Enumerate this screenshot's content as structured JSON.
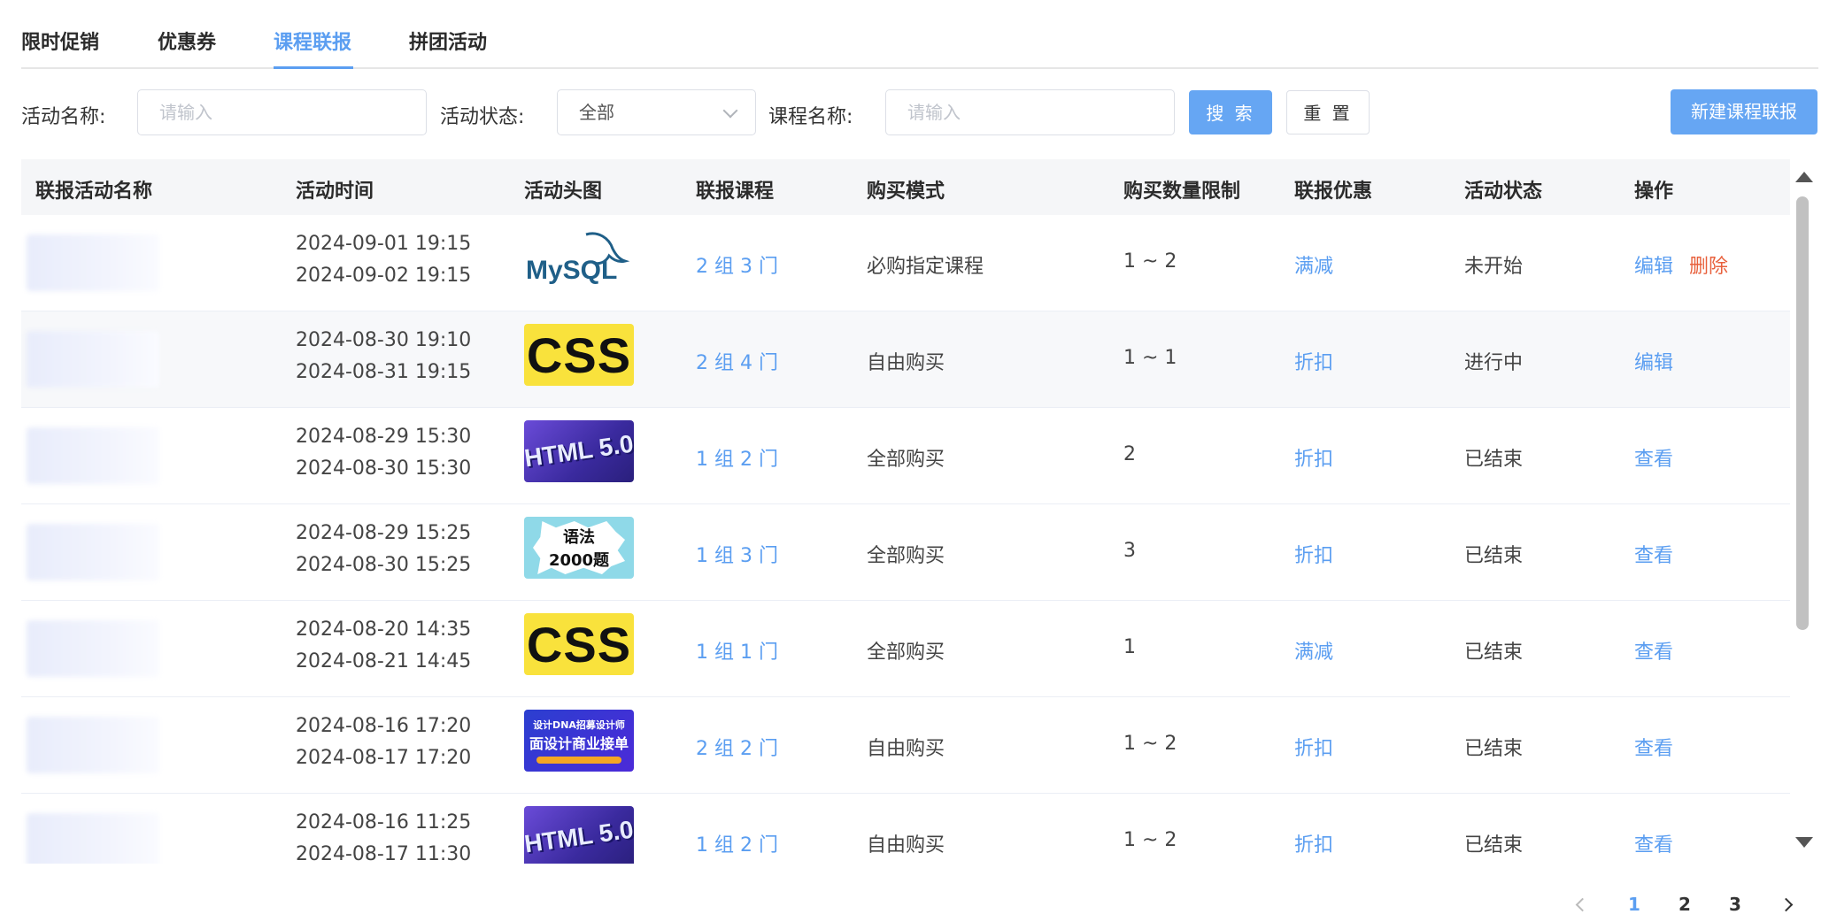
{
  "tabs": [
    {
      "label": "限时促销"
    },
    {
      "label": "优惠券"
    },
    {
      "label": "课程联报"
    },
    {
      "label": "拼团活动"
    }
  ],
  "active_tab": "课程联报",
  "filters": {
    "activity_name_label": "活动名称:",
    "activity_name_placeholder": "请输入",
    "status_label": "活动状态:",
    "status_value": "全部",
    "course_name_label": "课程名称:",
    "course_name_placeholder": "请输入",
    "search_label": "搜 索",
    "reset_label": "重 置",
    "new_label": "新建课程联报"
  },
  "table": {
    "headers": [
      "联报活动名称",
      "活动时间",
      "活动头图",
      "联报课程",
      "购买模式",
      "购买数量限制",
      "联报优惠",
      "活动状态",
      "操作"
    ],
    "rows": [
      {
        "start": "2024-09-01 19:15",
        "end": "2024-09-02 19:15",
        "thumb": "mysql",
        "courses": "2 组 3 门",
        "mode": "必购指定课程",
        "limit": "1 ~ 2",
        "discount": "满减",
        "status": "未开始",
        "actions": [
          "编辑",
          "删除"
        ]
      },
      {
        "start": "2024-08-30 19:10",
        "end": "2024-08-31 19:15",
        "thumb": "css",
        "courses": "2 组 4 门",
        "mode": "自由购买",
        "limit": "1 ~ 1",
        "discount": "折扣",
        "status": "进行中",
        "actions": [
          "编辑"
        ]
      },
      {
        "start": "2024-08-29 15:30",
        "end": "2024-08-30 15:30",
        "thumb": "html5",
        "courses": "1 组 2 门",
        "mode": "全部购买",
        "limit": "2",
        "discount": "折扣",
        "status": "已结束",
        "actions": [
          "查看"
        ]
      },
      {
        "start": "2024-08-29 15:25",
        "end": "2024-08-30 15:25",
        "thumb": "grammar",
        "courses": "1 组 3 门",
        "mode": "全部购买",
        "limit": "3",
        "discount": "折扣",
        "status": "已结束",
        "actions": [
          "查看"
        ]
      },
      {
        "start": "2024-08-20 14:35",
        "end": "2024-08-21 14:45",
        "thumb": "css",
        "courses": "1 组 1 门",
        "mode": "全部购买",
        "limit": "1",
        "discount": "满减",
        "status": "已结束",
        "actions": [
          "查看"
        ]
      },
      {
        "start": "2024-08-16 17:20",
        "end": "2024-08-17 17:20",
        "thumb": "design",
        "courses": "2 组 2 门",
        "mode": "自由购买",
        "limit": "1 ~ 2",
        "discount": "折扣",
        "status": "已结束",
        "actions": [
          "查看"
        ]
      },
      {
        "start": "2024-08-16 11:25",
        "end": "2024-08-17 11:30",
        "thumb": "html5",
        "courses": "1 组 2 门",
        "mode": "自由购买",
        "limit": "1 ~ 2",
        "discount": "折扣",
        "status": "已结束",
        "actions": [
          "查看"
        ]
      }
    ]
  },
  "thumb_text": {
    "mysql": "MySQL",
    "css": "CSS",
    "html5": "HTML 5.0",
    "grammar_line1": "语法",
    "grammar_line2": "2000题",
    "design_line1": "设计DNA招募设计师",
    "design_line2": "面设计商业接单"
  },
  "pagination": {
    "pages": [
      "1",
      "2",
      "3"
    ],
    "current": "1"
  },
  "colors": {
    "accent": "#5b9ef1",
    "danger": "#e8603c",
    "primary_button": "#66a6f3"
  }
}
